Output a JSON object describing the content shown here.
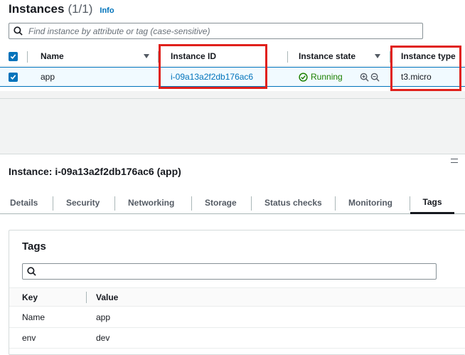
{
  "instances_panel": {
    "title": "Instances",
    "count": "(1/1)",
    "info_link": "Info",
    "search_placeholder": "Find instance by attribute or tag (case-sensitive)",
    "columns": {
      "name": "Name",
      "instance_id": "Instance ID",
      "instance_state": "Instance state",
      "instance_type": "Instance type"
    },
    "rows": [
      {
        "name": "app",
        "instance_id": "i-09a13a2f2db176ac6",
        "state": "Running",
        "type": "t3.micro"
      }
    ]
  },
  "details_panel": {
    "title": "Instance: i-09a13a2f2db176ac6 (app)",
    "tabs": [
      "Details",
      "Security",
      "Networking",
      "Storage",
      "Status checks",
      "Monitoring",
      "Tags"
    ],
    "active_tab": "Tags",
    "tags_section": {
      "title": "Tags",
      "columns": {
        "key": "Key",
        "value": "Value"
      },
      "rows": [
        {
          "key": "Name",
          "value": "app"
        },
        {
          "key": "env",
          "value": "dev"
        }
      ]
    }
  },
  "colors": {
    "link": "#0073bb",
    "running": "#1d8102",
    "highlight": "#e0201b",
    "selected_row": "#f1faff"
  },
  "icons": [
    "search-icon",
    "checkbox-checked-icon",
    "sort-caret-icon",
    "status-running-icon",
    "zoom-in-icon",
    "zoom-out-icon",
    "drag-handle-icon"
  ]
}
